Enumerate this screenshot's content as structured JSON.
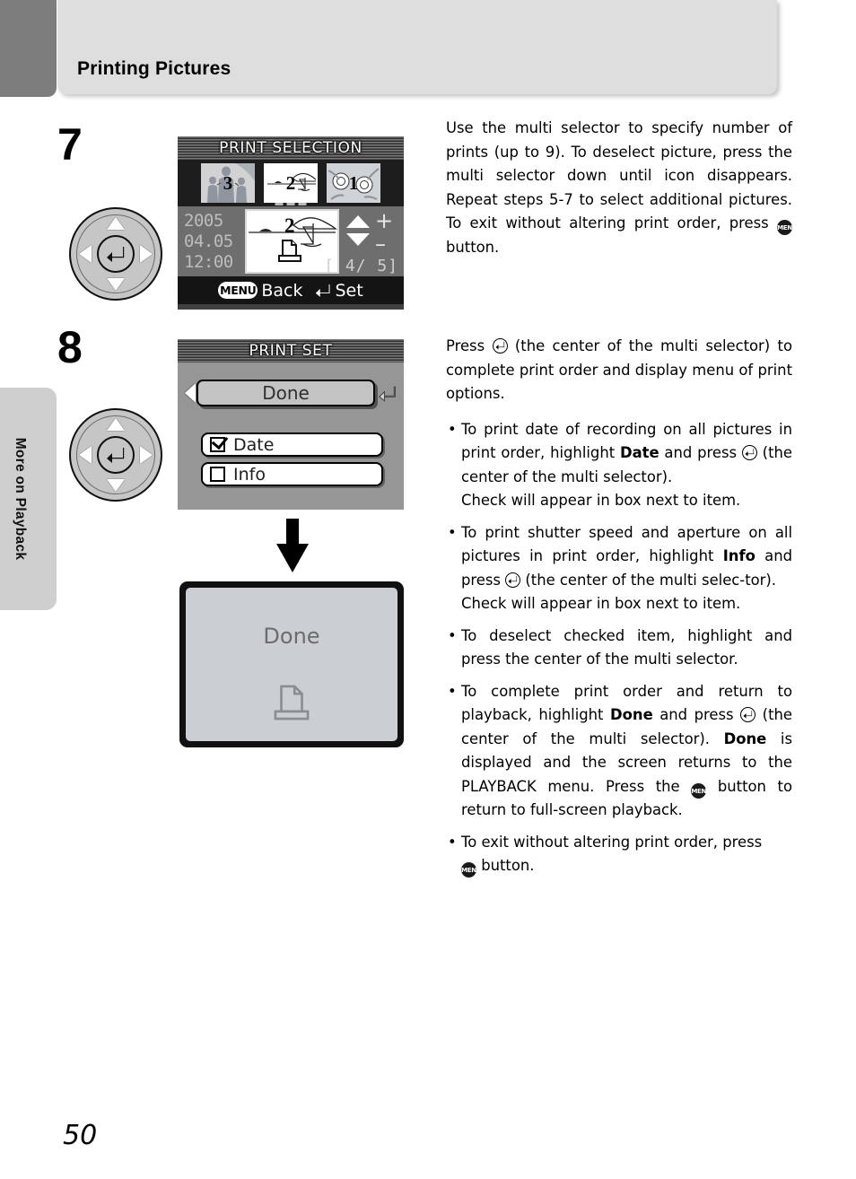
{
  "header": {
    "title": "Printing Pictures"
  },
  "side_tab": {
    "label": "More on Playback"
  },
  "page": {
    "number": "50"
  },
  "steps": [
    {
      "number": "7",
      "multi_selector": "multi-selector-dpad",
      "screen": {
        "title": "PRINT SELECTION",
        "thumbnails": [
          {
            "count": "3",
            "image": "family-photo",
            "selected": false
          },
          {
            "count": "2",
            "image": "sailboat-photo",
            "selected": true
          },
          {
            "count": "1",
            "image": "flowers-photo",
            "selected": false
          }
        ],
        "date": [
          "2005",
          "04.05",
          "12:00"
        ],
        "preview_count": "2",
        "plus_label": "+",
        "minus_label": "–",
        "counter": "[ 4/ 5]",
        "bottom_bar": {
          "menu_badge": "MENU",
          "back_label": "Back",
          "set_label": "Set"
        }
      },
      "body": {
        "text_1": "Use the multi selector to specify number of prints (up to 9). To deselect picture, press the multi selector down until icon disappears. Repeat steps 5-7 to select additional pictures. To exit without altering print order, press ",
        "text_2": " button."
      }
    },
    {
      "number": "8",
      "multi_selector": "multi-selector-dpad",
      "screen": {
        "title": "PRINT SET",
        "done_label": "Done",
        "options": [
          {
            "label": "Date",
            "checked": true
          },
          {
            "label": "Info",
            "checked": false
          }
        ]
      },
      "result_screen": {
        "message": "Done",
        "icon": "printer-icon"
      },
      "body": {
        "intro_a": "Press ",
        "intro_b": " (the center of the multi selector) to complete print order and display menu of print options.",
        "bullets": [
          {
            "a": "To print date of recording on all pictures in print order, highlight ",
            "bold1": "Date",
            "b": " and press ",
            "c": " (the center of the multi selector).",
            "d": "Check will appear in box next to item."
          },
          {
            "a": "To print shutter speed and aperture on all pictures in print order, highlight ",
            "bold1": "Info",
            "b": " and press ",
            "c": " (the center of the multi selec-tor).",
            "d": "Check will appear in box next to item."
          },
          {
            "a": "To deselect checked item, highlight and press the center of the multi selector."
          },
          {
            "a": "To complete print order and return to playback, highlight ",
            "bold1": "Done",
            "b": " and press ",
            "c": " (the center of the multi selector). ",
            "bold2": "Done",
            "d": " is displayed and the screen returns to the PLAYBACK menu. Press the ",
            "e": " button to return to full-screen playback."
          },
          {
            "a": "To exit without altering print order, press ",
            "e": " button."
          }
        ]
      }
    }
  ],
  "icons": {
    "menu_button": "MENU",
    "enter_button": "enter-icon"
  }
}
